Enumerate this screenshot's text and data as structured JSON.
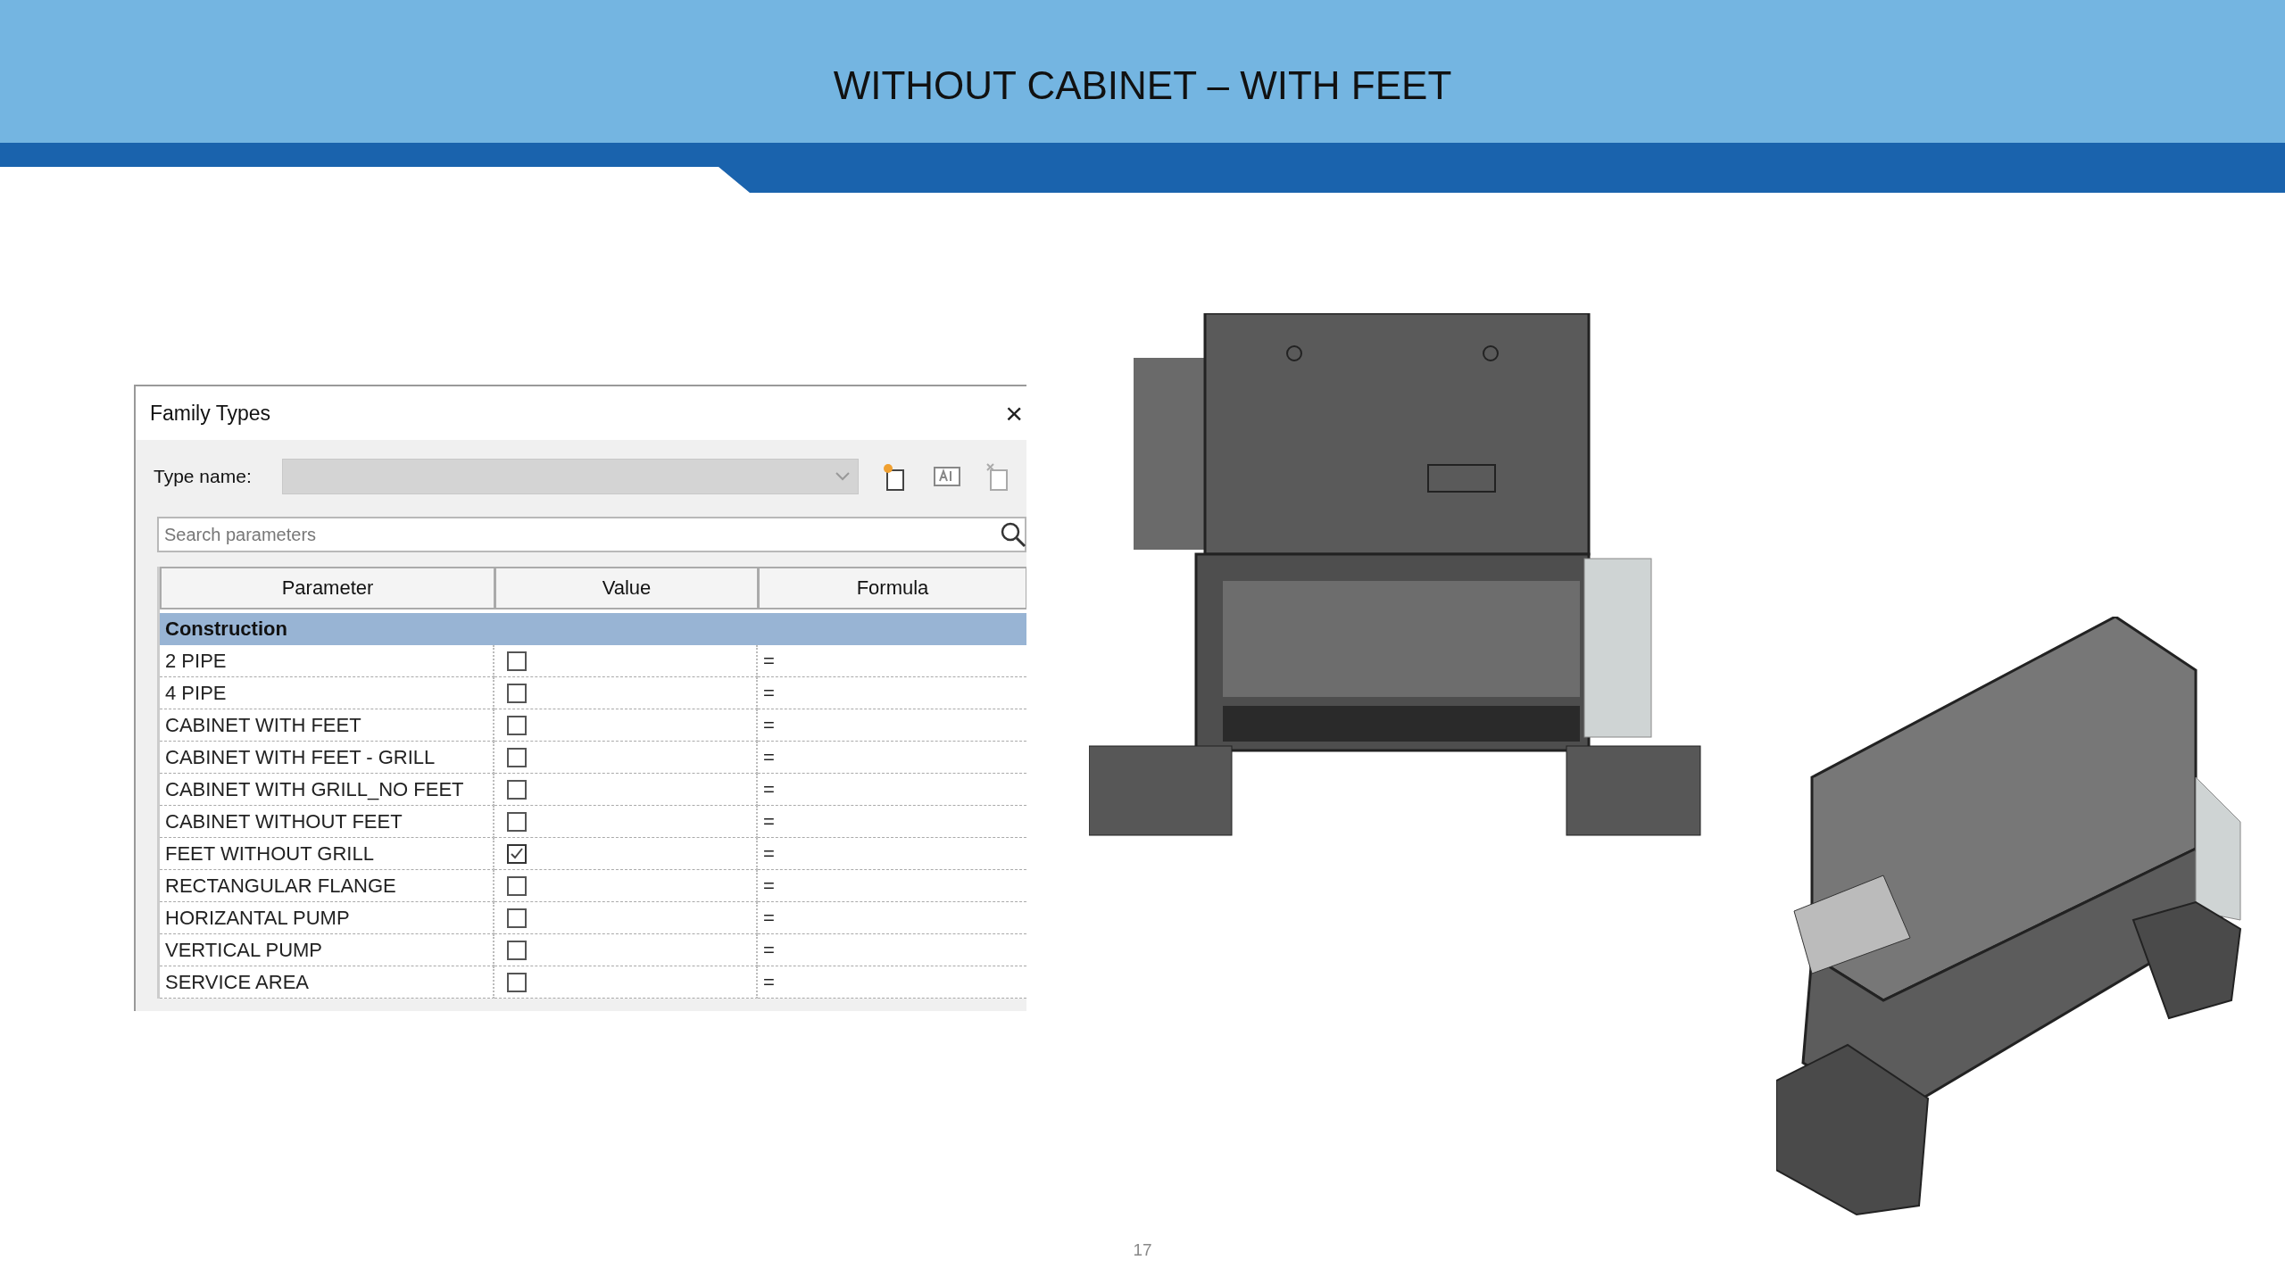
{
  "slide": {
    "title": "WITHOUT CABINET – WITH FEET",
    "page_number": "17"
  },
  "dialog": {
    "title": "Family Types",
    "close": "×",
    "type_name": {
      "label": "Type name:",
      "disabled": true
    },
    "search": {
      "placeholder": "Search parameters"
    },
    "table": {
      "columns": [
        "Parameter",
        "Value",
        "Formula"
      ],
      "group": "Construction",
      "rows": [
        {
          "parameter": "2 PIPE",
          "checked": false,
          "formula": "="
        },
        {
          "parameter": "4 PIPE",
          "checked": false,
          "formula": "="
        },
        {
          "parameter": "CABINET WITH FEET",
          "checked": false,
          "formula": "="
        },
        {
          "parameter": "CABINET WITH FEET - GRILL",
          "checked": false,
          "formula": "="
        },
        {
          "parameter": "CABINET WITH GRILL_NO FEET",
          "checked": false,
          "formula": "="
        },
        {
          "parameter": "CABINET WITHOUT FEET",
          "checked": false,
          "formula": "="
        },
        {
          "parameter": "FEET WITHOUT GRILL",
          "checked": true,
          "formula": "="
        },
        {
          "parameter": "RECTANGULAR FLANGE",
          "checked": false,
          "formula": "="
        },
        {
          "parameter": "HORIZANTAL PUMP",
          "checked": false,
          "formula": "="
        },
        {
          "parameter": "VERTICAL PUMP",
          "checked": false,
          "formula": "="
        },
        {
          "parameter": "SERVICE AREA",
          "checked": false,
          "formula": "="
        }
      ]
    }
  }
}
